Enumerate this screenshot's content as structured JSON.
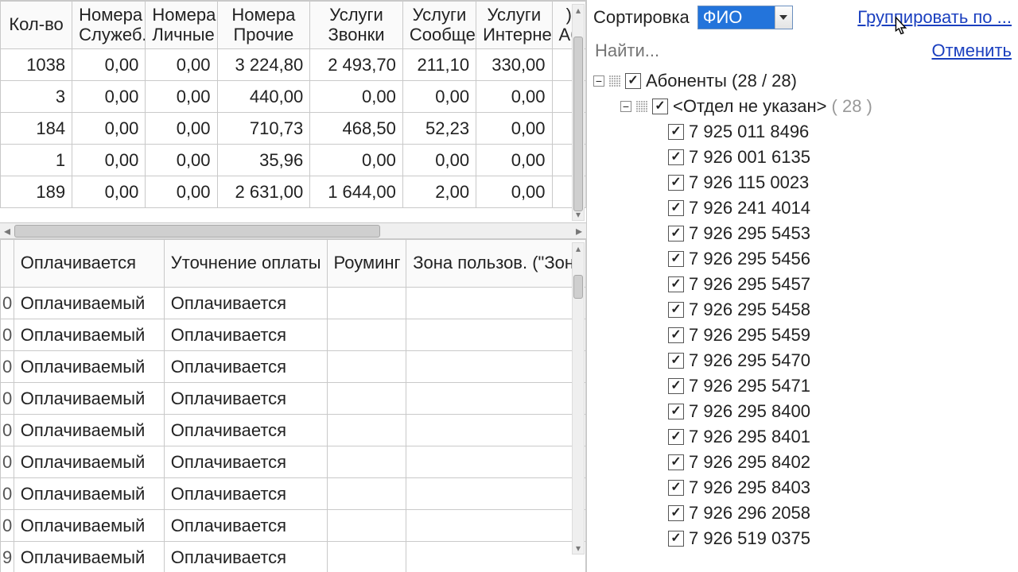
{
  "top_table": {
    "headers": [
      "Кол-во",
      "Номера Служеб.",
      "Номера Личные",
      "Номера Прочие",
      "Услуги Звонки",
      "Услуги Сообще",
      "Услуги Интерне",
      ")\nАб"
    ],
    "rows": [
      [
        "1038",
        "0,00",
        "0,00",
        "3 224,80",
        "2 493,70",
        "211,10",
        "330,00",
        ""
      ],
      [
        "3",
        "0,00",
        "0,00",
        "440,00",
        "0,00",
        "0,00",
        "0,00",
        ""
      ],
      [
        "184",
        "0,00",
        "0,00",
        "710,73",
        "468,50",
        "52,23",
        "0,00",
        ""
      ],
      [
        "1",
        "0,00",
        "0,00",
        "35,96",
        "0,00",
        "0,00",
        "0,00",
        ""
      ],
      [
        "189",
        "0,00",
        "0,00",
        "2 631,00",
        "1 644,00",
        "2,00",
        "0,00",
        ""
      ]
    ]
  },
  "bottom_table": {
    "headers": [
      "",
      "Оплачивается",
      "Уточнение оплаты",
      "Роуминг",
      "Зона пользов. (\"Зона"
    ],
    "rows": [
      [
        "0",
        "Оплачиваемый",
        "Оплачивается",
        "",
        ""
      ],
      [
        "0",
        "Оплачиваемый",
        "Оплачивается",
        "",
        ""
      ],
      [
        "0",
        "Оплачиваемый",
        "Оплачивается",
        "",
        ""
      ],
      [
        "0",
        "Оплачиваемый",
        "Оплачивается",
        "",
        ""
      ],
      [
        "0",
        "Оплачиваемый",
        "Оплачивается",
        "",
        ""
      ],
      [
        "0",
        "Оплачиваемый",
        "Оплачивается",
        "",
        ""
      ],
      [
        "0",
        "Оплачиваемый",
        "Оплачивается",
        "",
        ""
      ],
      [
        "0",
        "Оплачиваемый",
        "Оплачивается",
        "",
        ""
      ],
      [
        "9",
        "Оплачиваемый",
        "Оплачивается",
        "",
        ""
      ]
    ]
  },
  "right": {
    "sort_label": "Сортировка",
    "sort_value": "ФИО",
    "group_link": "Группировать по ...",
    "cancel_link": "Отменить",
    "search_placeholder": "Найти...",
    "root_label": "Абоненты (28 / 28)",
    "dept_label": "<Отдел не указан>",
    "dept_count": "( 28 )",
    "phones": [
      "7  925  011 8496",
      "7  926  001 6135",
      "7  926  115 0023",
      "7  926  241 4014",
      "7  926  295 5453",
      "7  926  295 5456",
      "7  926  295 5457",
      "7  926  295 5458",
      "7  926  295 5459",
      "7  926  295 5470",
      "7  926  295 5471",
      "7  926  295 8400",
      "7  926  295 8401",
      "7  926  295 8402",
      "7  926  295 8403",
      "7  926  296 2058",
      "7  926  519 0375"
    ]
  }
}
